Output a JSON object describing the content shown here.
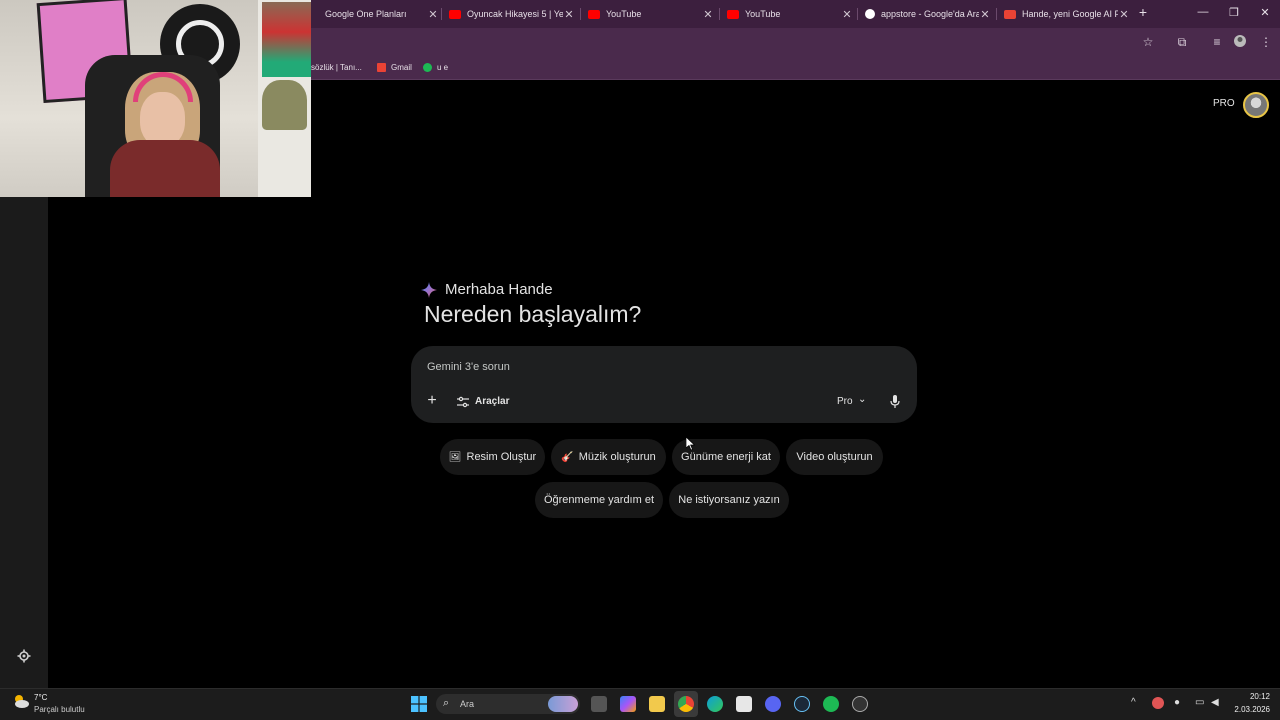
{
  "browser": {
    "tabs": [
      {
        "title": "Google One Planları",
        "color": "#4285f4"
      },
      {
        "title": "Oyuncak Hikayesi 5 | Yeni",
        "color": "#ff0000"
      },
      {
        "title": "YouTube",
        "color": "#ff0000"
      },
      {
        "title": "YouTube",
        "color": "#ff0000"
      },
      {
        "title": "appstore - Google'da Ara",
        "color": "#ffffff"
      },
      {
        "title": "Hande, yeni Google AI Pr",
        "color": "#ea4335"
      }
    ],
    "new_tab_label": "+",
    "bookmarks": [
      {
        "label": "sözlük | Tanı...",
        "color": "#888888"
      },
      {
        "label": "Gmail",
        "color": "#ea4335"
      },
      {
        "label": "u e",
        "color": "#1db954"
      }
    ]
  },
  "header": {
    "plan_badge": "PRO"
  },
  "main": {
    "greeting_sub": "Merhaba Hande",
    "greeting_main": "Nereden başlayalım?",
    "prompt_placeholder": "Gemini 3'e sorun",
    "tools_label": "Araçlar",
    "model_label": "Pro",
    "chips": [
      {
        "label": "Resim Oluştur",
        "icon": "🖼"
      },
      {
        "label": "Müzik oluşturun",
        "icon": "🎸"
      },
      {
        "label": "Günüme enerji kat",
        "icon": ""
      },
      {
        "label": "Video oluşturun",
        "icon": ""
      },
      {
        "label": "Öğrenmeme yardım et",
        "icon": ""
      },
      {
        "label": "Ne istiyorsanız yazın",
        "icon": ""
      }
    ]
  },
  "taskbar": {
    "weather_temp": "7°C",
    "weather_desc": "Parçalı bulutlu",
    "search_label": "Ara",
    "time": "20:12",
    "date": "2.03.2026"
  },
  "colors": {
    "accent_gemini": "#4285f4",
    "chrome_tab_bg": "#3c1f3e",
    "page_bg": "#000000"
  }
}
